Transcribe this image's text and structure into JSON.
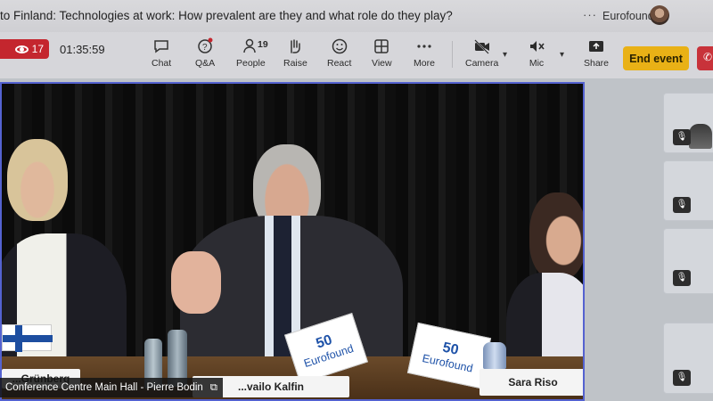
{
  "window": {
    "title": "to Finland: Technologies at work: How prevalent are they and what role do they play?",
    "more_dots": "···",
    "org": "Eurofound"
  },
  "toolbar": {
    "viewer_count": "17",
    "timer": "01:35:59",
    "chat_label": "Chat",
    "qa_label": "Q&A",
    "people_label": "People",
    "people_count": "19",
    "raise_label": "Raise",
    "react_label": "React",
    "view_label": "View",
    "more_label": "More",
    "camera_label": "Camera",
    "mic_label": "Mic",
    "share_label": "Share",
    "end_event_label": "End event"
  },
  "video": {
    "nameplates": [
      "...Grünberg",
      "...vailo Kalfin",
      "Sara Riso"
    ],
    "eurofound_word": "Eurofound",
    "eurofound_anniv": "50",
    "caption": "Conference Centre Main Hall - Pierre Bodin"
  },
  "colors": {
    "live_red": "#c4262e",
    "end_event_yellow": "#e9b116",
    "video_border": "#5462d0"
  }
}
